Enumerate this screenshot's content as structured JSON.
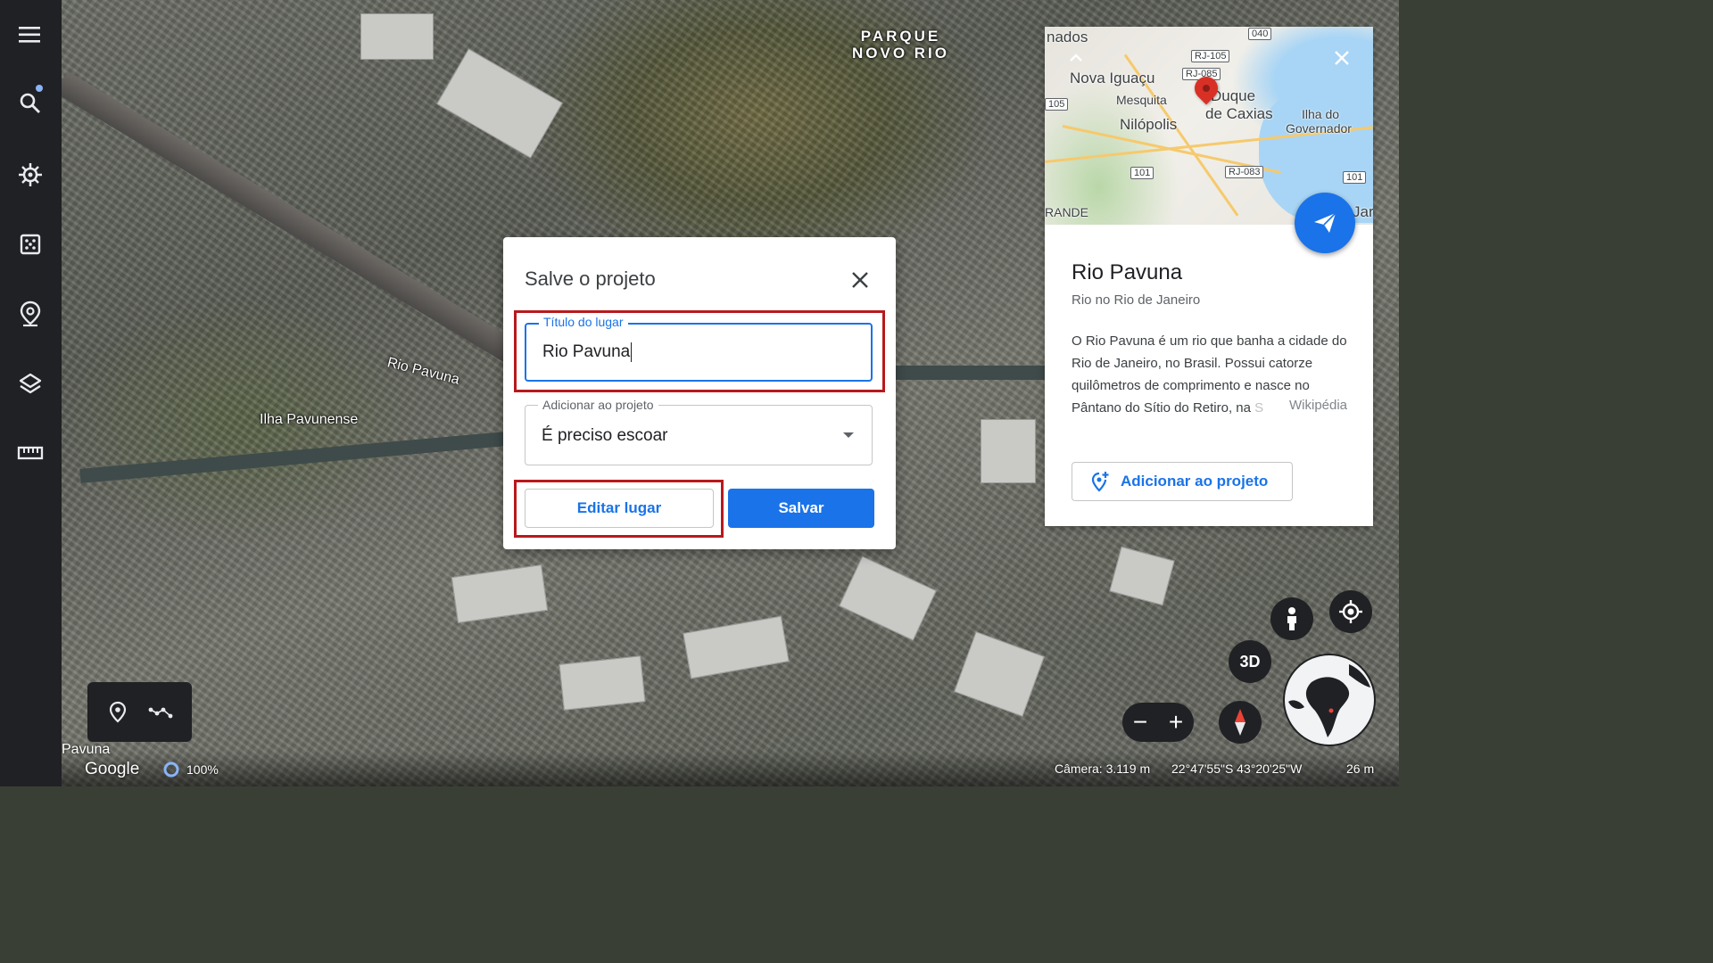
{
  "sidebar": {
    "items": [
      {
        "name": "menu-icon",
        "label": "Menu"
      },
      {
        "name": "search-icon",
        "label": "Pesquisar"
      },
      {
        "name": "voyager-icon",
        "label": "Voyager"
      },
      {
        "name": "dice-icon",
        "label": "Estou com sorte"
      },
      {
        "name": "projects-icon",
        "label": "Projetos"
      },
      {
        "name": "layers-icon",
        "label": "Estilo do mapa"
      },
      {
        "name": "ruler-icon",
        "label": "Medir distância"
      }
    ]
  },
  "map": {
    "labels": {
      "parque_line1": "PARQUE",
      "parque_line2": "NOVO RIO",
      "rio_pavuna": "Rio Pavuna",
      "ilha": "Ilha Pavunense",
      "pavuna_bottom": "Pavuna"
    }
  },
  "dialog": {
    "title": "Salve o projeto",
    "title_field": {
      "label": "Título do lugar",
      "value": "Rio Pavuna"
    },
    "project_field": {
      "label": "Adicionar ao projeto",
      "value": "É preciso escoar"
    },
    "edit_button": "Editar lugar",
    "save_button": "Salvar"
  },
  "card": {
    "minimap": {
      "labels": [
        "nados",
        "Nova Iguaçu",
        "Mesquita",
        "Nilópolis",
        "Duque",
        "de Caxias",
        "Ilha do",
        "Governador",
        "RANDE",
        "Jar"
      ],
      "shields": [
        "040",
        "RJ-105",
        "RJ-085",
        "105",
        "101",
        "RJ-083",
        "101"
      ]
    },
    "title": "Rio Pavuna",
    "subtitle": "Rio no Rio de Janeiro",
    "description": "O Rio Pavuna é um rio que banha a cidade do Rio de Janeiro, no Brasil. Possui catorze quilômetros de comprimento e nasce no Pântano do Sítio do Retiro, na",
    "description_fade": "S",
    "source": "Wikipédia",
    "add_button": "Adicionar ao projeto"
  },
  "controls": {
    "three_d": "3D",
    "zoom_out": "−",
    "zoom_in": "+"
  },
  "status": {
    "logo": "Google",
    "streaming": "100%",
    "camera": "Câmera: 3.119 m",
    "coordinates": "22°47'55\"S 43°20'25\"W",
    "scale": "26 m"
  },
  "colors": {
    "accent": "#1a73e8",
    "highlight": "#b8191c",
    "rail": "#202124"
  }
}
